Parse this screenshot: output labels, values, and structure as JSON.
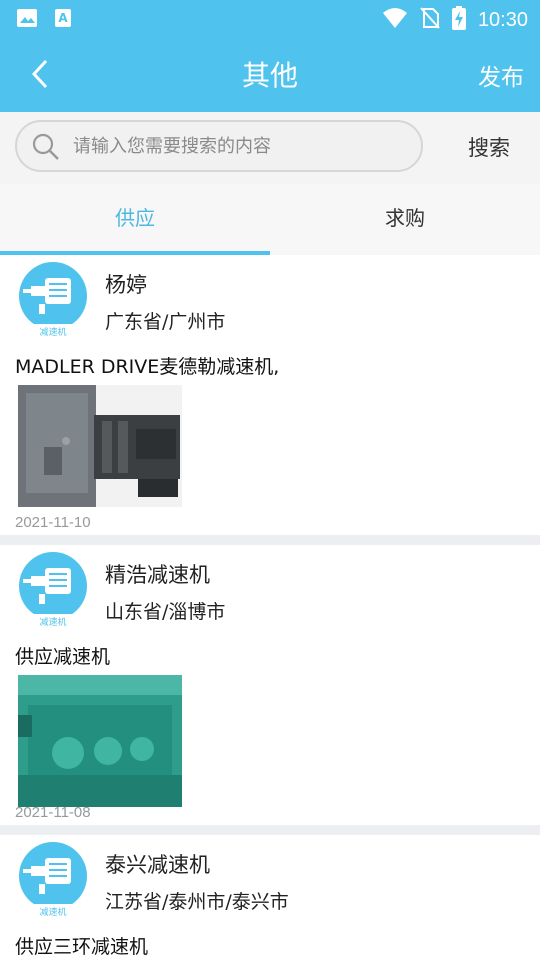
{
  "status_bar": {
    "time": "10:30",
    "left_icons": [
      "image-icon",
      "text-a-icon"
    ],
    "right_icons": [
      "wifi-icon",
      "no-sim-icon",
      "battery-charging-icon"
    ]
  },
  "header": {
    "title": "其他",
    "publish_label": "发布",
    "back_icon": "chevron-left-icon"
  },
  "search": {
    "placeholder": "请输入您需要搜索的内容",
    "value": "",
    "button_label": "搜索"
  },
  "tabs": [
    {
      "label": "供应",
      "active": true
    },
    {
      "label": "求购",
      "active": false
    }
  ],
  "colors": {
    "primary": "#4fc3ed",
    "active_tab": "#4fb8e0",
    "divider": "#eceef1",
    "date": "#999999"
  },
  "posts": [
    {
      "name": "杨婷",
      "location": "广东省/广州市",
      "description": "MADLER DRIVE麦德勒减速机,",
      "date": "2021-11-10",
      "logo_caption": "减速机",
      "photo": "grey-gear-motor"
    },
    {
      "name": "精浩减速机",
      "location": "山东省/淄博市",
      "description": "供应减速机",
      "date": "2021-11-08",
      "logo_caption": "减速机",
      "photo": "green-gearbox"
    },
    {
      "name": "泰兴减速机",
      "location": "江苏省/泰州市/泰兴市",
      "description": "供应三环减速机",
      "date": "",
      "logo_caption": "减速机",
      "photo": ""
    }
  ]
}
